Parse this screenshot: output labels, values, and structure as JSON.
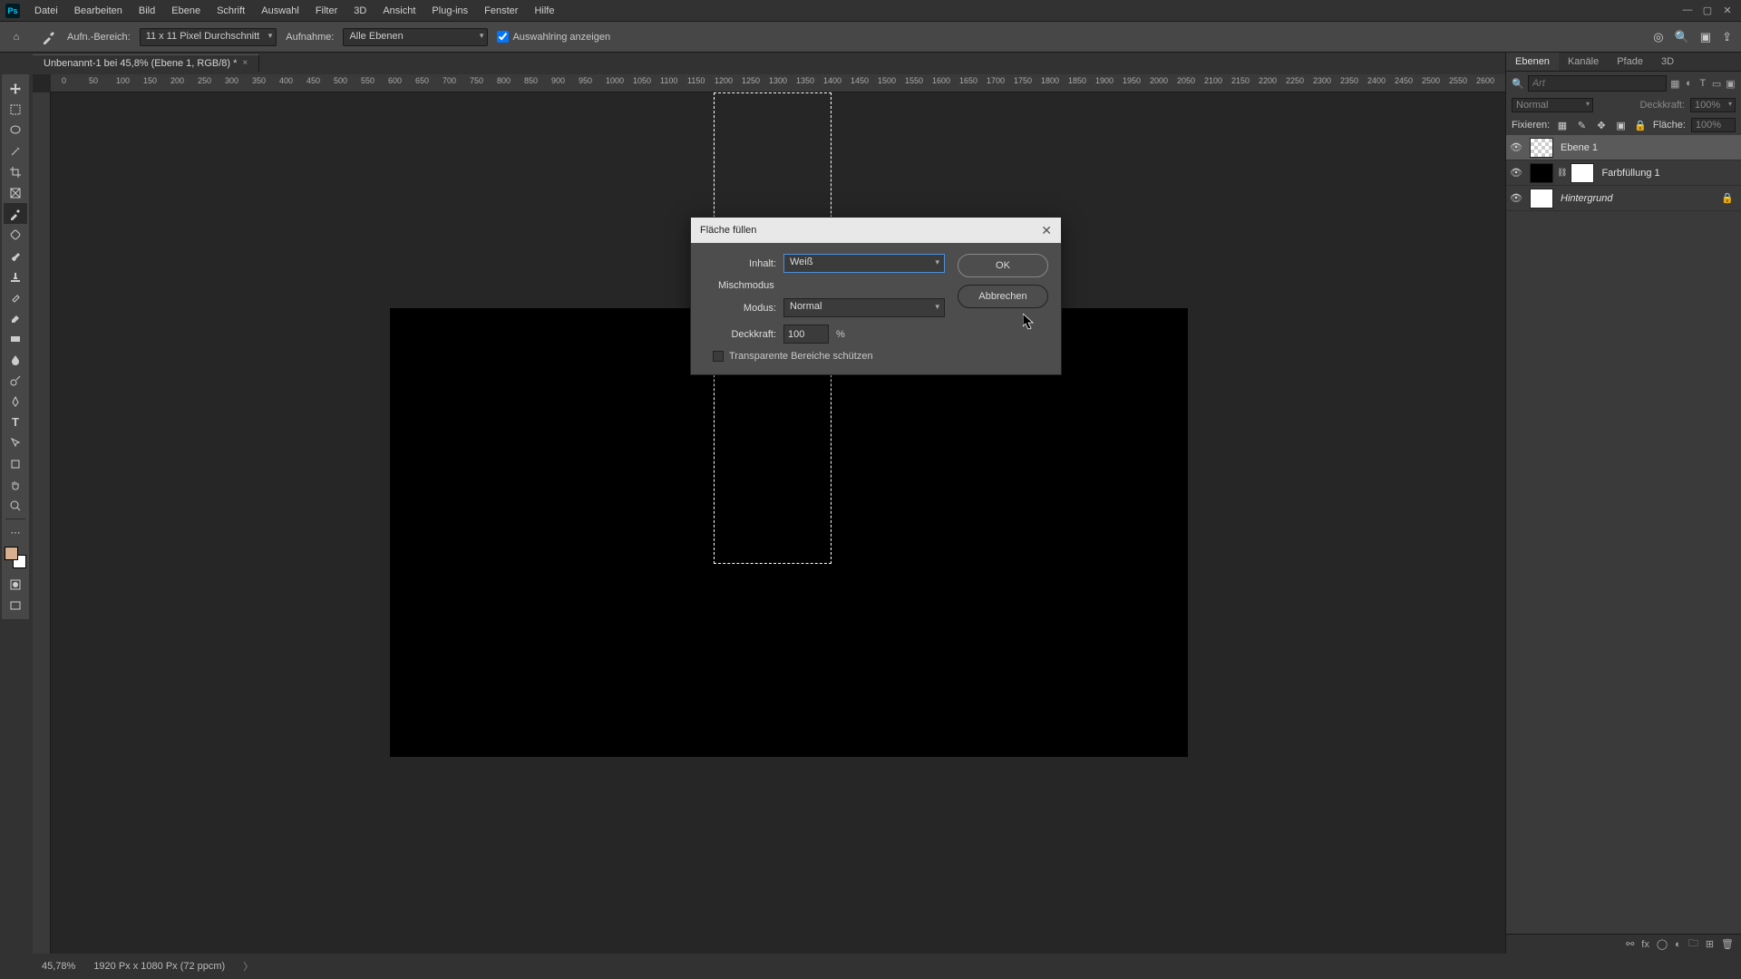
{
  "menu": {
    "items": [
      "Datei",
      "Bearbeiten",
      "Bild",
      "Ebene",
      "Schrift",
      "Auswahl",
      "Filter",
      "3D",
      "Ansicht",
      "Plug-ins",
      "Fenster",
      "Hilfe"
    ]
  },
  "optbar": {
    "sample_label": "Aufn.-Bereich:",
    "sample_value": "11 x 11 Pixel Durchschnitt",
    "layers_label": "Aufnahme:",
    "layers_value": "Alle Ebenen",
    "show_ring": "Auswahlring anzeigen"
  },
  "doctab": {
    "title": "Unbenannt-1 bei 45,8% (Ebene 1, RGB/8) *"
  },
  "ruler": {
    "marks": [
      "0",
      "50",
      "100",
      "150",
      "200",
      "250",
      "300",
      "350",
      "400",
      "450",
      "500",
      "550",
      "600",
      "650",
      "700",
      "750",
      "800",
      "850",
      "900",
      "950",
      "1000",
      "1050",
      "1100",
      "1150",
      "1200",
      "1250",
      "1300",
      "1350",
      "1400",
      "1450",
      "1500",
      "1550",
      "1600",
      "1650",
      "1700",
      "1750",
      "1800",
      "1850",
      "1900",
      "1950",
      "2000",
      "2050",
      "2100",
      "2150",
      "2200",
      "2250",
      "2300",
      "2350",
      "2400",
      "2450",
      "2500",
      "2550",
      "2600"
    ]
  },
  "panels": {
    "tabs": [
      "Ebenen",
      "Kanäle",
      "Pfade",
      "3D"
    ],
    "search_placeholder": "Art",
    "blend_label": "Normal",
    "opacity_label": "Deckkraft:",
    "opacity_value": "100%",
    "lock_label": "Fixieren:",
    "fill_label": "Fläche:",
    "fill_value": "100%",
    "layers": [
      {
        "name": "Ebene 1",
        "thumb": "checker",
        "selected": true,
        "visible": true
      },
      {
        "name": "Farbfüllung 1",
        "thumb": "black",
        "mask": true,
        "visible": true
      },
      {
        "name": "Hintergrund",
        "thumb": "white",
        "locked": true,
        "italic": true,
        "visible": true
      }
    ]
  },
  "status": {
    "zoom": "45,78%",
    "info": "1920 Px x 1080 Px (72 ppcm)"
  },
  "dialog": {
    "title": "Fläche füllen",
    "content_label": "Inhalt:",
    "content_value": "Weiß",
    "blend_section": "Mischmodus",
    "mode_label": "Modus:",
    "mode_value": "Normal",
    "opacity_label": "Deckkraft:",
    "opacity_value": "100",
    "pct": "%",
    "preserve": "Transparente Bereiche schützen",
    "ok": "OK",
    "cancel": "Abbrechen"
  }
}
